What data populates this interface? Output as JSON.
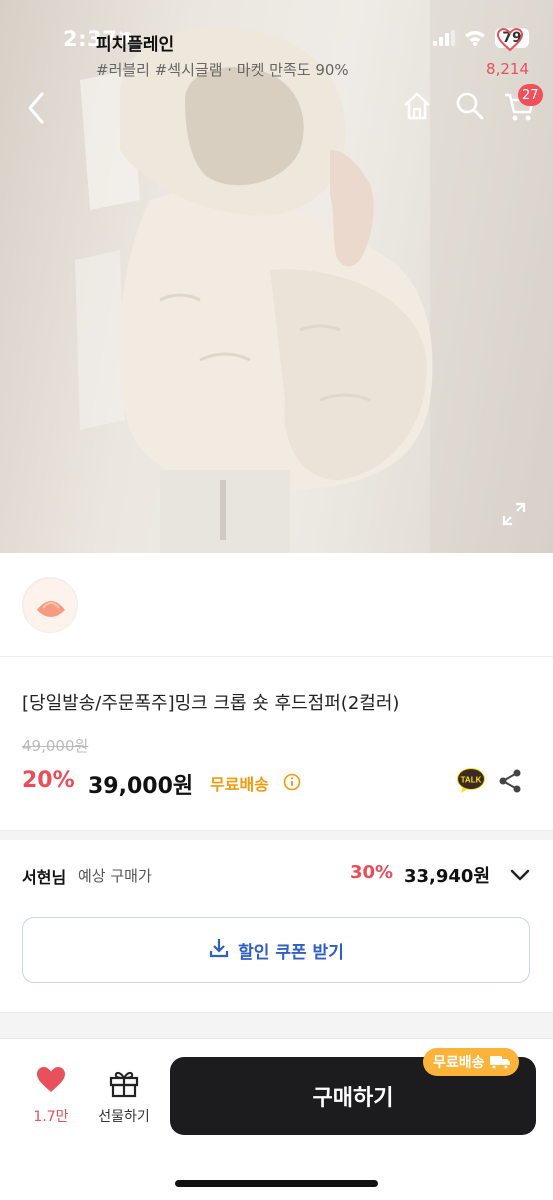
{
  "status_bar": {
    "time": "2:37",
    "battery": "79"
  },
  "nav": {
    "cart_badge": "27"
  },
  "shop": {
    "name": "피치플레인",
    "tags": "#러블리 #섹시글램 · 마켓 만족도 90%",
    "like_count": "8,214"
  },
  "product": {
    "title": "[당일발송/주문폭주]밍크 크롭 숏 후드점퍼(2컬러)",
    "original_price": "49,000원",
    "discount": "20%",
    "price": "39,000원",
    "free_shipping": "무료배송",
    "talk_label": "TALK"
  },
  "member": {
    "name": "서현님",
    "label": "예상 구매가",
    "discount": "30%",
    "price": "33,940원"
  },
  "coupon": {
    "label": "할인 쿠폰 받기"
  },
  "bottom_bar": {
    "wish_count": "1.7만",
    "gift_label": "선물하기",
    "buy_label": "구매하기",
    "shipping_pill": "무료배송"
  },
  "colors": {
    "accent_red": "#ec4b58",
    "coupon_blue": "#2f5fc4",
    "shipping_orange": "#f29a0f",
    "buy_button": "#1c1c1e"
  },
  "icons": [
    "back-icon",
    "home-icon",
    "search-icon",
    "cart-icon",
    "expand-icon",
    "heart-icon",
    "info-icon",
    "talk-icon",
    "share-icon",
    "chevron-down-icon",
    "download-icon",
    "gift-icon",
    "truck-icon"
  ]
}
